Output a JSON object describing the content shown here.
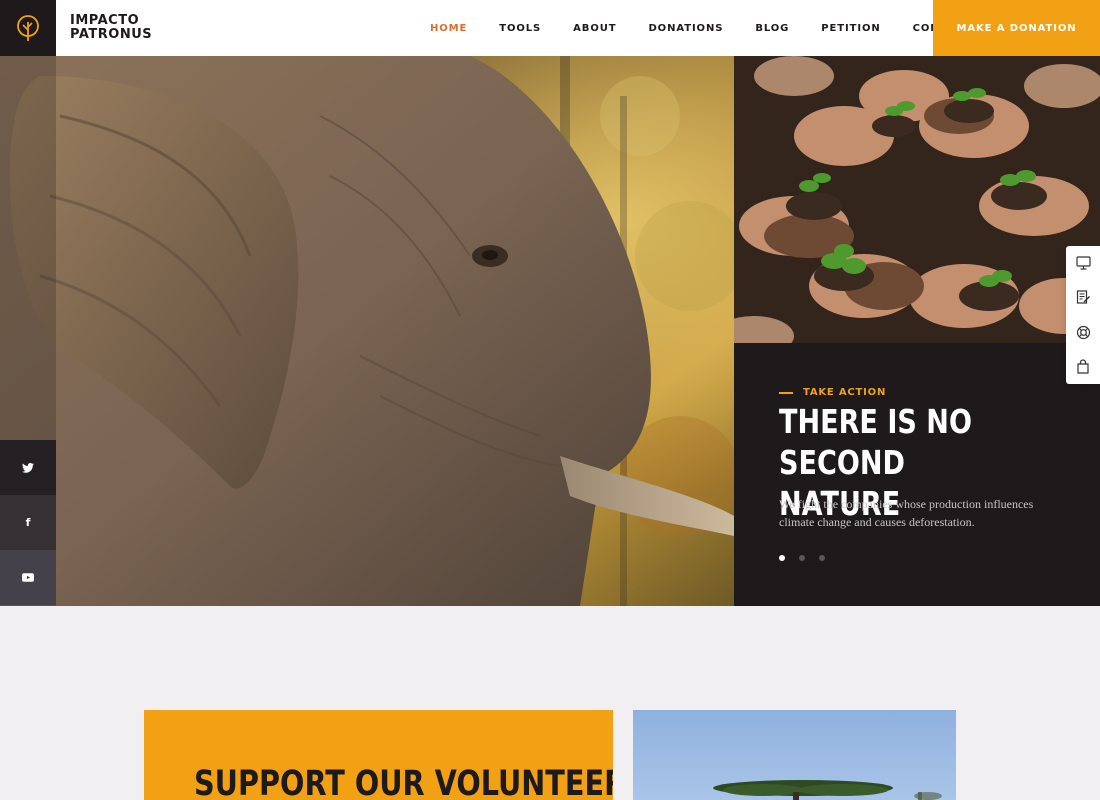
{
  "header": {
    "logo_icon": "tree-icon",
    "brand_line1": "IMPACTO",
    "brand_line2": "PATRONUS",
    "nav": [
      {
        "label": "HOME",
        "active": true
      },
      {
        "label": "TOOLS",
        "active": false
      },
      {
        "label": "ABOUT",
        "active": false
      },
      {
        "label": "DONATIONS",
        "active": false
      },
      {
        "label": "BLOG",
        "active": false
      },
      {
        "label": "PETITION",
        "active": false
      },
      {
        "label": "CONTACTS",
        "active": false
      }
    ],
    "donate_label": "MAKE A DONATION"
  },
  "hero": {
    "eyebrow": "TAKE ACTION",
    "title": "THERE IS NO SECOND\nNATURE",
    "text": "We fight the companies whose production influences climate change and causes deforestation.",
    "slide_count": 3,
    "active_slide": 1
  },
  "social": [
    "twitter-icon",
    "facebook-icon",
    "youtube-icon"
  ],
  "side_panel": [
    "monitor-icon",
    "document-edit-icon",
    "support-icon",
    "shopping-bag-icon"
  ],
  "section": {
    "title": "SUPPORT OUR VOLUNTEER"
  },
  "colors": {
    "accent": "#f2a114",
    "nav_active": "#e66a2c",
    "dark": "#1e1a1c",
    "page_bg": "#f1eff2"
  }
}
